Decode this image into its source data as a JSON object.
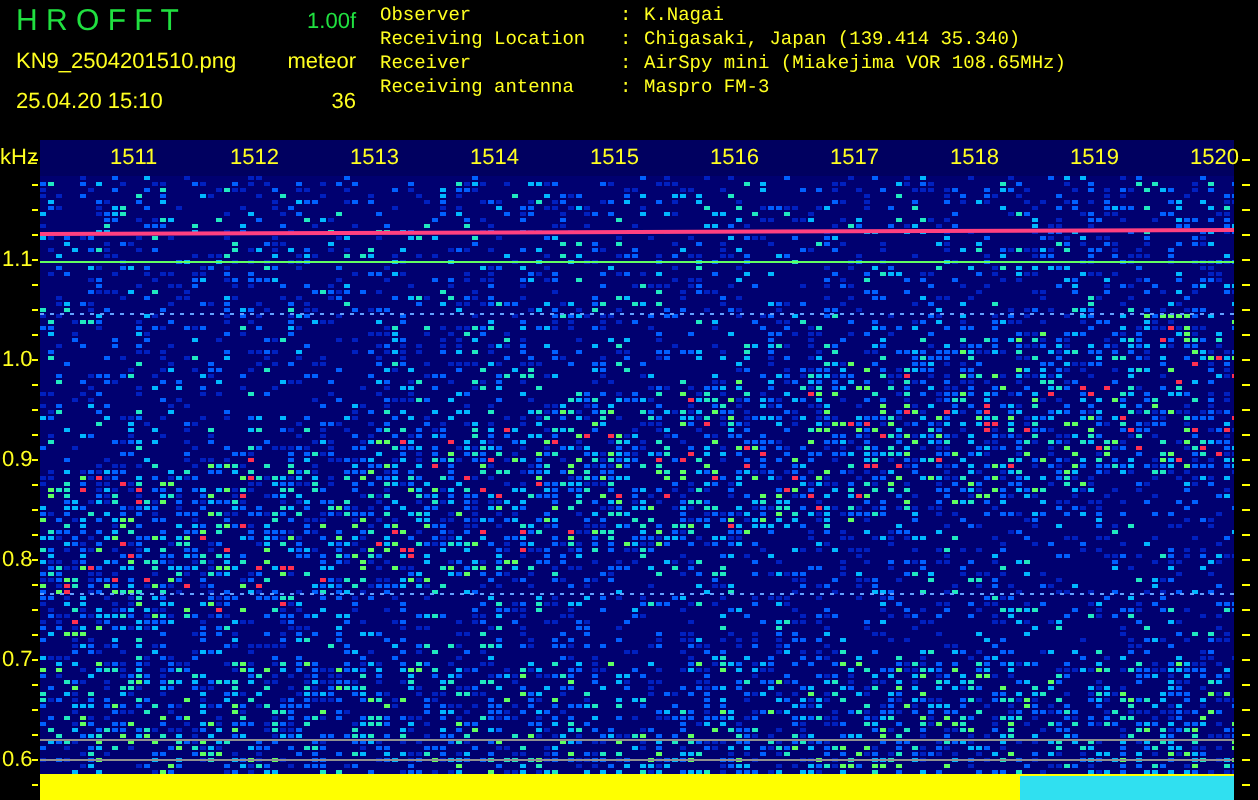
{
  "header": {
    "title": "H R O F F T",
    "version": "1.00f",
    "filename": "KN9_2504201510.png",
    "datetime": "25.04.20 15:10",
    "count_label": "meteor",
    "count": "36"
  },
  "info": [
    {
      "label": "Observer",
      "separator": ":",
      "value": "K.Nagai"
    },
    {
      "label": "Receiving Location",
      "separator": ":",
      "value": "Chigasaki, Japan (139.414 35.340)"
    },
    {
      "label": "Receiver",
      "separator": ":",
      "value": "AirSpy mini (Miakejima VOR 108.65MHz)"
    },
    {
      "label": "Receiving antenna",
      "separator": ":",
      "value": "Maspro FM-3"
    }
  ],
  "spectrogram": {
    "y_unit": "kHz",
    "y_ticks": [
      "1.1",
      "1.0",
      "0.9",
      "0.8",
      "0.7",
      "0.6"
    ],
    "x_ticks": [
      "1511",
      "1512",
      "1513",
      "1514",
      "1515",
      "1516",
      "1517",
      "1518",
      "1519",
      "1520"
    ]
  }
}
